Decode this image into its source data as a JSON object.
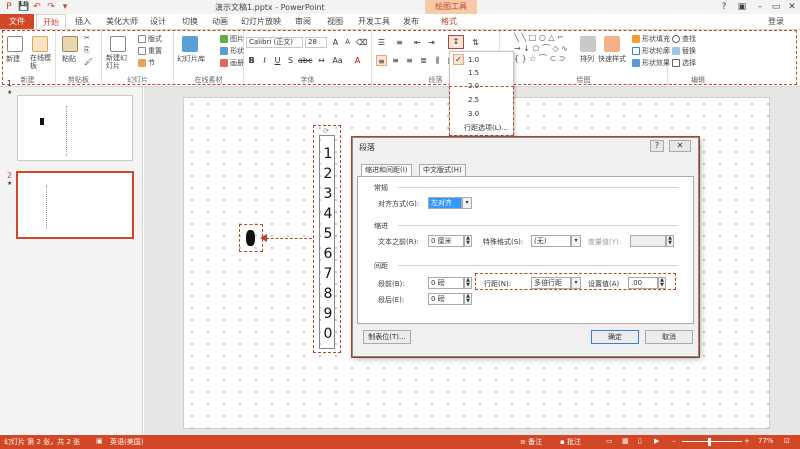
{
  "window": {
    "title": "演示文稿1.pptx - PowerPoint",
    "context_tab": "绘图工具",
    "help": "?",
    "min": "–",
    "restore": "▭",
    "close": "✕"
  },
  "quick_access": [
    "💾",
    "↶",
    "↷",
    "▾"
  ],
  "tabs": {
    "file": "文件",
    "items": [
      "开始",
      "插入",
      "美化大师",
      "设计",
      "切换",
      "动画",
      "幻灯片放映",
      "审阅",
      "视图",
      "开发工具",
      "发布",
      "格式"
    ],
    "active": "开始",
    "login": "登录"
  },
  "ribbon": {
    "new_label": "新建",
    "online_template": "在线模板",
    "group_new": "新建",
    "paste": "粘贴",
    "group_clipboard": "剪贴板",
    "new_slide": "新建幻灯片",
    "layout": "版式",
    "reset": "重置",
    "section": "节",
    "group_slides": "幻灯片",
    "slide_library": "幻灯片库",
    "image": "图片",
    "shape": "形状",
    "canvas": "画册",
    "group_online": "在线素材",
    "font_name": "Calibri (正文)",
    "font_size": "28",
    "group_font": "字体",
    "group_paragraph": "段落",
    "arrange": "排列",
    "quick_styles": "快速样式",
    "shape_fill": "形状填充",
    "shape_outline": "形状轮廓",
    "shape_effects": "形状效果",
    "group_drawing": "绘图",
    "find": "查找",
    "replace": "替换",
    "select": "选择",
    "group_edit": "编辑"
  },
  "line_spacing_menu": {
    "options": [
      "1.0",
      "1.5",
      "2.0",
      "2.5",
      "3.0"
    ],
    "more": "行距选项(L)...",
    "checked": "1.0"
  },
  "slides": [
    {
      "num": "1",
      "star": "★"
    },
    {
      "num": "2",
      "star": "★"
    }
  ],
  "numbers": [
    "1",
    "2",
    "3",
    "4",
    "5",
    "6",
    "7",
    "8",
    "9",
    "0"
  ],
  "dialog": {
    "title": "段落",
    "tab_indent": "缩进和间距(I)",
    "tab_chinese": "中文版式(H)",
    "sect_general": "常规",
    "align_label": "对齐方式(G):",
    "align_value": "左对齐",
    "sect_indent": "缩进",
    "before_text_label": "文本之前(R):",
    "before_text_value": "0 厘米",
    "special_label": "特殊格式(S):",
    "special_value": "(无)",
    "measure_label": "度量值(Y):",
    "sect_spacing": "间距",
    "before_label": "段前(B):",
    "before_value": "0 磅",
    "after_label": "段后(E):",
    "after_value": "0 磅",
    "line_label": "行距(N):",
    "line_value": "多倍行距",
    "set_label": "设置值(A)",
    "set_value": ".00",
    "tabs_button": "制表位(T)...",
    "ok": "确定",
    "cancel": "取消"
  },
  "status": {
    "slide_info": "幻灯片 第 2 张，共 2 张",
    "language": "英语(美国)",
    "notes": "备注",
    "comments": "批注",
    "zoom": "77%"
  },
  "colors": {
    "accent": "#d24726",
    "annotation": "#b7472a"
  }
}
